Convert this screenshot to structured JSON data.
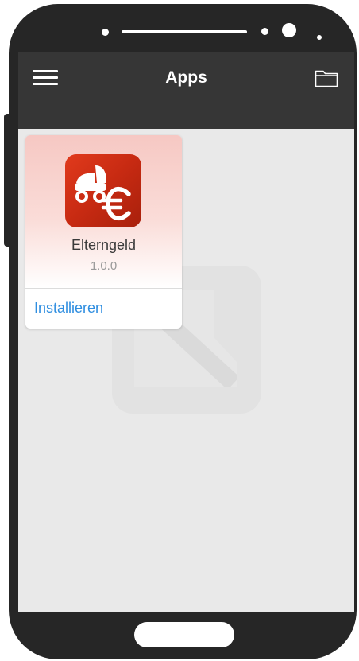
{
  "header": {
    "title": "Apps",
    "menu_icon": "hamburger-menu-icon",
    "folder_icon": "folder-icon"
  },
  "apps": [
    {
      "name": "Elterngeld",
      "version": "1.0.0",
      "install_label": "Installieren",
      "icon": "stroller-euro-icon"
    }
  ],
  "colors": {
    "header_bg": "#363636",
    "screen_bg": "#e9e9e9",
    "link": "#2f8ee0",
    "app_icon": "#d0311a",
    "phone_body": "#262626"
  }
}
